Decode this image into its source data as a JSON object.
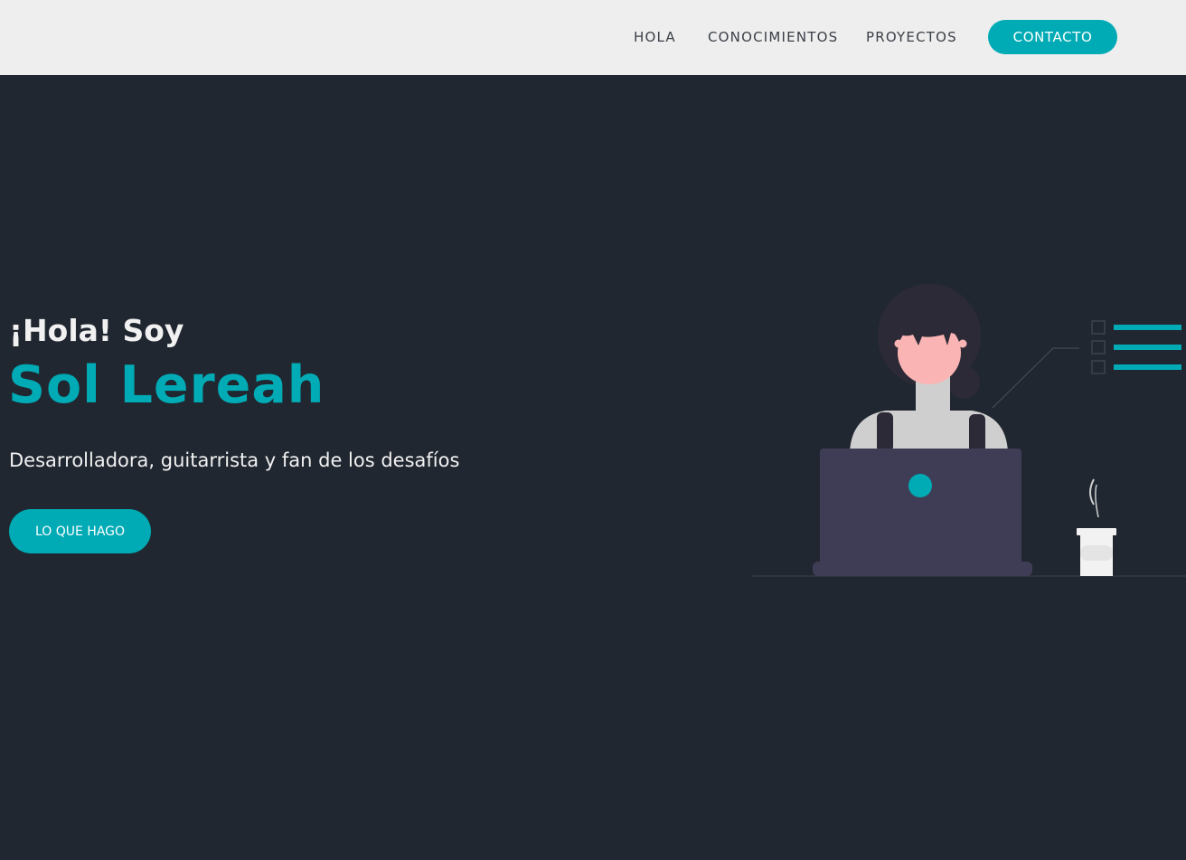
{
  "nav": {
    "links": [
      {
        "label": "HOLA"
      },
      {
        "label": "CONOCIMIENTOS"
      },
      {
        "label": "PROYECTOS"
      }
    ],
    "contact_label": "CONTACTO"
  },
  "hero": {
    "greeting": "¡Hola! Soy",
    "name": "Sol Lereah",
    "tagline": "Desarrolladora, guitarrista y fan de los desafíos",
    "cta_label": "LO QUE HAGO"
  },
  "colors": {
    "accent": "#00abb5",
    "background": "#212731",
    "navbar": "#eeeeee",
    "text_light": "#f1f1f1"
  },
  "icons": {
    "illustration": "woman-at-laptop-illustration",
    "coffee": "coffee-cup-icon",
    "checklist": "checklist-icon"
  }
}
